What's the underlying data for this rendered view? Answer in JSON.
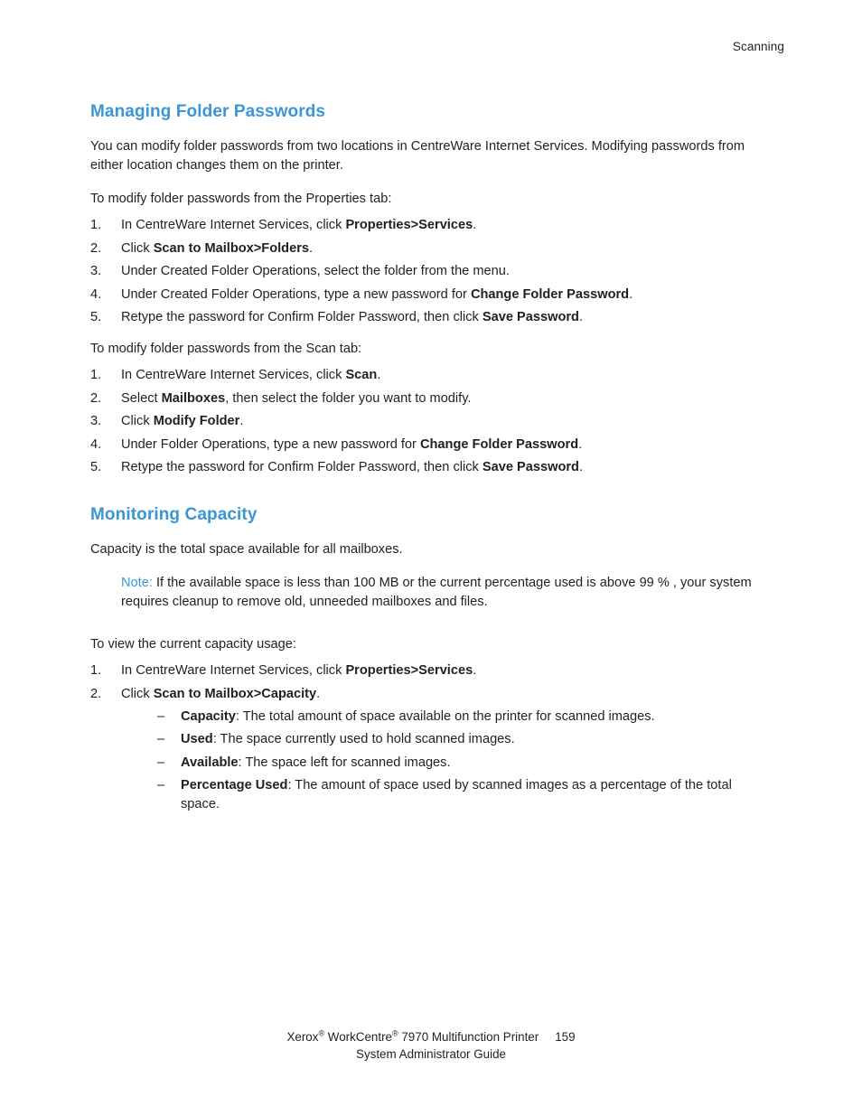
{
  "header": {
    "running_head": "Scanning"
  },
  "sections": [
    {
      "heading": "Managing Folder Passwords",
      "intro": "You can modify folder passwords from two locations in CentreWare Internet Services. Modifying passwords from either location changes them on the printer.",
      "lead_in_1": "To modify folder passwords from the Properties tab:",
      "steps_1": [
        {
          "pre": "In CentreWare Internet Services, click ",
          "bold": "Properties>Services",
          "post": "."
        },
        {
          "pre": "Click ",
          "bold": "Scan to Mailbox>Folders",
          "post": "."
        },
        {
          "pre": "Under Created Folder Operations, select the folder from the menu.",
          "bold": "",
          "post": ""
        },
        {
          "pre": "Under Created Folder Operations, type a new password for ",
          "bold": "Change Folder Password",
          "post": "."
        },
        {
          "pre": "Retype the password for Confirm Folder Password, then click ",
          "bold": "Save Password",
          "post": "."
        }
      ],
      "lead_in_2": "To modify folder passwords from the Scan tab:",
      "steps_2": [
        {
          "pre": "In CentreWare Internet Services, click ",
          "bold": "Scan",
          "post": "."
        },
        {
          "pre": "Select ",
          "bold": "Mailboxes",
          "post": ", then select the folder you want to modify."
        },
        {
          "pre": "Click ",
          "bold": "Modify Folder",
          "post": "."
        },
        {
          "pre": "Under Folder Operations, type a new password for ",
          "bold": "Change Folder Password",
          "post": "."
        },
        {
          "pre": "Retype the password for Confirm Folder Password, then click ",
          "bold": "Save Password",
          "post": "."
        }
      ]
    },
    {
      "heading": "Monitoring Capacity",
      "intro": "Capacity is the total space available for all mailboxes.",
      "note_label": "Note:",
      "note_text": "If the available space is less than 100 MB or the current percentage used is above 99 % , your system requires cleanup to remove old, unneeded mailboxes and files.",
      "lead_in_1": "To view the current capacity usage:",
      "steps_1": [
        {
          "pre": "In CentreWare Internet Services, click ",
          "bold": "Properties>Services",
          "post": "."
        },
        {
          "pre": "Click ",
          "bold": "Scan to Mailbox>Capacity",
          "post": "."
        }
      ],
      "sub_items": [
        {
          "bold": "Capacity",
          "post": ": The total amount of space available on the printer for scanned images."
        },
        {
          "bold": "Used",
          "post": ": The space currently used to hold scanned images."
        },
        {
          "bold": "Available",
          "post": ": The space left for scanned images."
        },
        {
          "bold": "Percentage Used",
          "post": ": The amount of space used by scanned images as a percentage of the total space."
        }
      ]
    }
  ],
  "footer": {
    "product_pre": "Xerox",
    "product_mid": " WorkCentre",
    "product_post": " 7970 Multifunction Printer",
    "guide_line": "System Administrator Guide",
    "page_number": "159",
    "registered_mark": "®"
  },
  "colors": {
    "heading_blue": "#3a96d4",
    "body_black": "#231f20",
    "page_background": "#ffffff"
  }
}
